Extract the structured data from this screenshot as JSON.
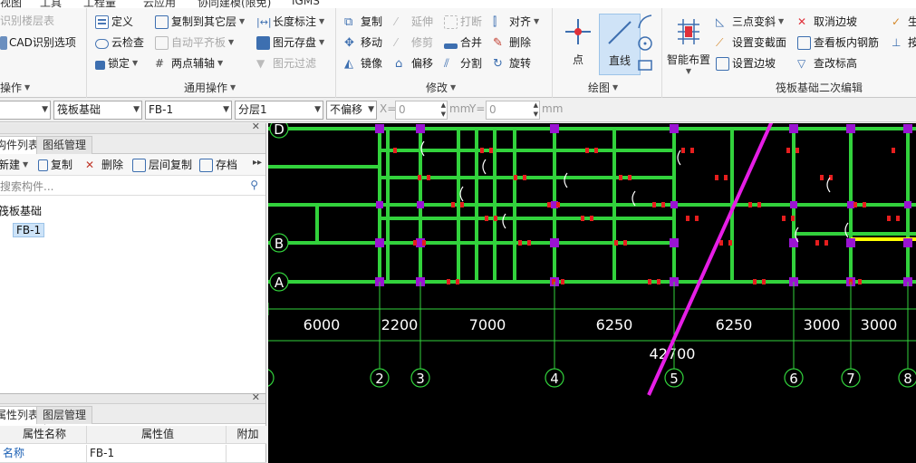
{
  "menu": {
    "items": [
      "视图",
      "工具",
      "工程量",
      "云应用",
      "协同建模(限免)",
      "IGMS"
    ]
  },
  "ribbon": {
    "groups": {
      "cad": {
        "items": [
          "识别楼层表",
          "CAD识别选项"
        ],
        "label": "操作"
      },
      "general": {
        "label": "通用操作",
        "items": [
          "定义",
          "云检查",
          "锁定",
          "复制到其它层",
          "自动平齐板",
          "两点辅轴",
          "长度标注",
          "图元存盘",
          "图元过滤"
        ]
      },
      "modify": {
        "label": "修改",
        "items": [
          "复制",
          "移动",
          "镜像",
          "延伸",
          "修剪",
          "偏移",
          "打断",
          "合并",
          "分割",
          "对齐",
          "删除",
          "旋转"
        ]
      },
      "draw": {
        "label": "绘图",
        "items": [
          "点",
          "直线"
        ]
      },
      "raft": {
        "label": "筏板基础二次编辑",
        "items": [
          "智能布置",
          "三点变斜",
          "设置变截面",
          "设置边坡",
          "取消边坡",
          "查看板内钢筋",
          "查改标高",
          "生",
          "按"
        ]
      }
    }
  },
  "toolbar": {
    "combos": [
      "",
      "筏板基础",
      "FB-1",
      "分层1",
      "不偏移"
    ],
    "x_label": "X=",
    "x_value": "0",
    "unit_x": "mm",
    "y_label": "Y=",
    "y_value": "0",
    "unit_y": "mm"
  },
  "component_panel": {
    "tabs": [
      "构件列表",
      "图纸管理"
    ],
    "tools": [
      "新建",
      "复制",
      "删除",
      "层间复制",
      "存档"
    ],
    "search_placeholder": "搜索构件...",
    "tree": {
      "category": "筏板基础",
      "item": "FB-1"
    }
  },
  "property_panel": {
    "tabs": [
      "属性列表",
      "图层管理"
    ],
    "headers": [
      "属性名称",
      "属性值",
      "附加"
    ],
    "rows": [
      {
        "name": "名称",
        "value": "FB-1"
      }
    ]
  },
  "drawing": {
    "axis_rows": [
      "D",
      "B",
      "A"
    ],
    "axis_cols": [
      "2",
      "3",
      "4",
      "5",
      "6",
      "7",
      "8"
    ],
    "dimensions": [
      "6000",
      "2200",
      "7000",
      "6250",
      "6250",
      "3000",
      "3000"
    ],
    "total_dimension": "42700"
  },
  "colors": {
    "beam": "#32d23c",
    "column": "#9a14d2",
    "annotation": "#ffffff",
    "arrow": "#e61ee6",
    "highlight": "#ffff00",
    "marker": "#e61e1e"
  }
}
